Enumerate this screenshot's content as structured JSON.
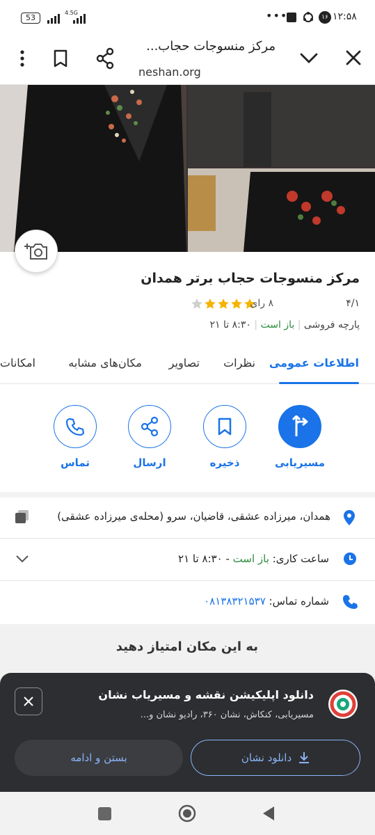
{
  "status": {
    "time": "۱۲:۵۸",
    "battery": "53",
    "network": "4.5G",
    "badge": "۱۶"
  },
  "browser": {
    "title": "مرکز منسوجات حجاب...",
    "url": "neshan.org"
  },
  "place": {
    "title": "مرکز منسوجات حجاب برتر همدان",
    "rating": "۴/۱",
    "stars": 4,
    "votes": "۸ رای",
    "category": "پارچه فروشی",
    "open_status": "باز است",
    "hours": "۸:۳۰ تا ۲۱"
  },
  "tabs": [
    "اطلاعات عمومی",
    "نظرات",
    "تصاویر",
    "مکان‌های مشابه",
    "امکانات"
  ],
  "actions": {
    "route": "مسیریابی",
    "save": "ذخیره",
    "share": "ارسال",
    "call": "تماس"
  },
  "info": {
    "address": "همدان، میرزاده عشقی، قاضیان، سرو (محله‌ی میرزاده عشقی)",
    "hours_label": "ساعت کاری:",
    "hours_status": "باز است",
    "hours_range": "- ۸:۳۰ تا ۲۱",
    "phone_label": "شماره تماس:",
    "phone": "۰۸۱۳۸۳۲۱۵۳۷"
  },
  "rate": {
    "title": "به این مکان امتیاز دهید"
  },
  "banner": {
    "title": "دانلود اپلیکیشن نقشه و مسیریاب نشان",
    "subtitle": "مسیریابی، کنکاش، نشان ۳۶۰، رادیو نشان و...",
    "download": "دانلود نشان",
    "continue": "بستن و ادامه"
  },
  "colors": {
    "accent": "#1a73e8",
    "open": "#2e8b3e",
    "star": "#f5b400",
    "banner_bg": "#2d2e31"
  }
}
